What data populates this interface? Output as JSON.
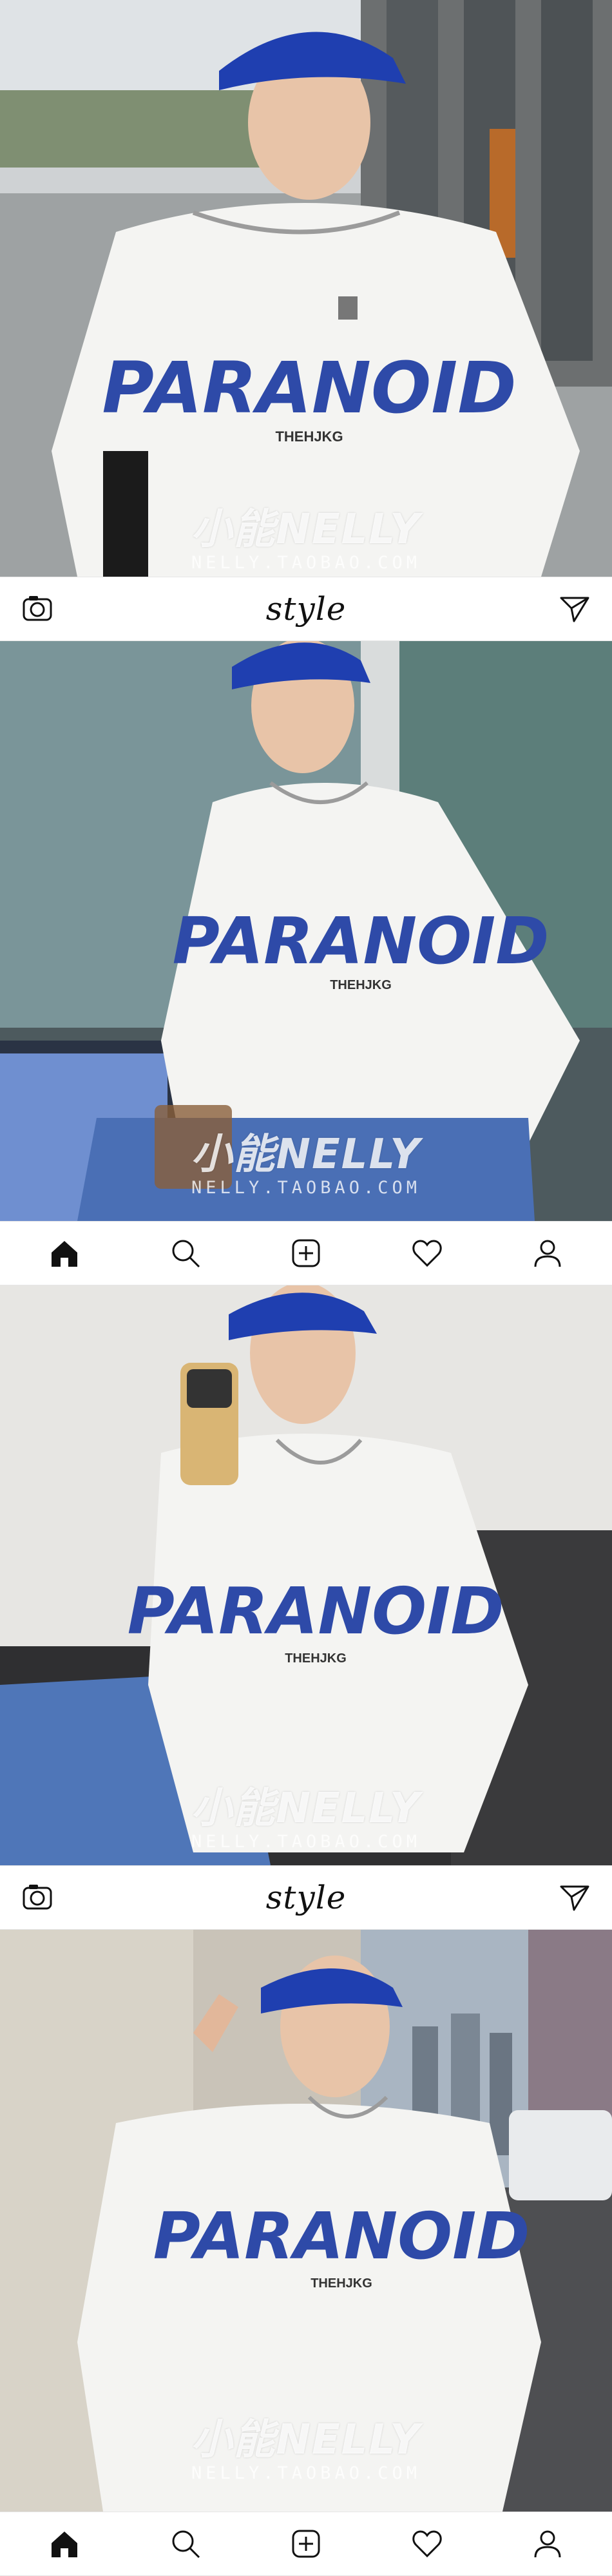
{
  "app": {
    "brand_text": "style"
  },
  "top_bar": {
    "icons": [
      "camera-icon",
      "send-icon"
    ]
  },
  "bottom_nav": {
    "icons": [
      "home-icon",
      "search-icon",
      "add-post-icon",
      "heart-icon",
      "profile-icon"
    ]
  },
  "photos": [
    {
      "shirt_print": "PARANOID",
      "shirt_tag": "THEHJKG",
      "watermark": "小能NELLY",
      "watermark_url": "NELLY.TAOBAO.COM"
    },
    {
      "shirt_print": "PARANOID",
      "shirt_tag": "THEHJKG",
      "watermark": "小能NELLY",
      "watermark_url": "NELLY.TAOBAO.COM"
    },
    {
      "shirt_print": "PARANOID",
      "shirt_tag": "THEHJKG",
      "watermark": "小能NELLY",
      "watermark_url": "NELLY.TAOBAO.COM"
    },
    {
      "shirt_print": "PARANOID",
      "shirt_tag": "THEHJKG",
      "watermark": "小能NELLY",
      "watermark_url": "NELLY.TAOBAO.COM"
    }
  ],
  "colors": {
    "cap_blue": "#1f3fb0",
    "print_blue": "#2e4aa8",
    "shirt_white": "#f4f4f2",
    "bar_bg": "#ffffff",
    "icon_dark": "#111111"
  }
}
